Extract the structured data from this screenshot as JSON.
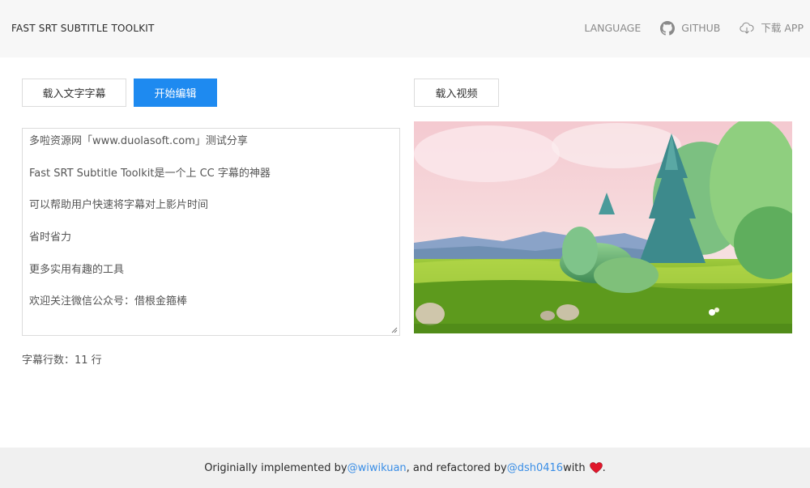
{
  "header": {
    "title": "FAST SRT SUBTITLE TOOLKIT",
    "nav": {
      "language": "LANGUAGE",
      "github": "GITHUB",
      "download": "下载 APP"
    }
  },
  "toolbar": {
    "load_text_label": "载入文字字幕",
    "start_edit_label": "开始编辑",
    "load_video_label": "载入视频"
  },
  "editor": {
    "lines": [
      "多啦资源网「www.duolasoft.com」测试分享",
      "Fast SRT Subtitle Toolkit是一个上 CC 字幕的神器",
      "可以帮助用户快速将字幕对上影片时间",
      "省时省力",
      "更多实用有趣的工具",
      "欢迎关注微信公众号：借根金箍棒"
    ]
  },
  "status": {
    "line_count_text": "字幕行数：11 行"
  },
  "footer": {
    "prefix": "Originially implemented by ",
    "author1": "@wiwikuan",
    "middle": ", and refactored by ",
    "author2": "@dsh0416",
    "suffix": " with",
    "end": "."
  },
  "icons": {
    "github": "github-icon",
    "download": "cloud-download-icon",
    "heart": "heart-icon"
  },
  "colors": {
    "accent": "#1e8af0",
    "link": "#3a8ee6",
    "heart": "#e0162b"
  }
}
